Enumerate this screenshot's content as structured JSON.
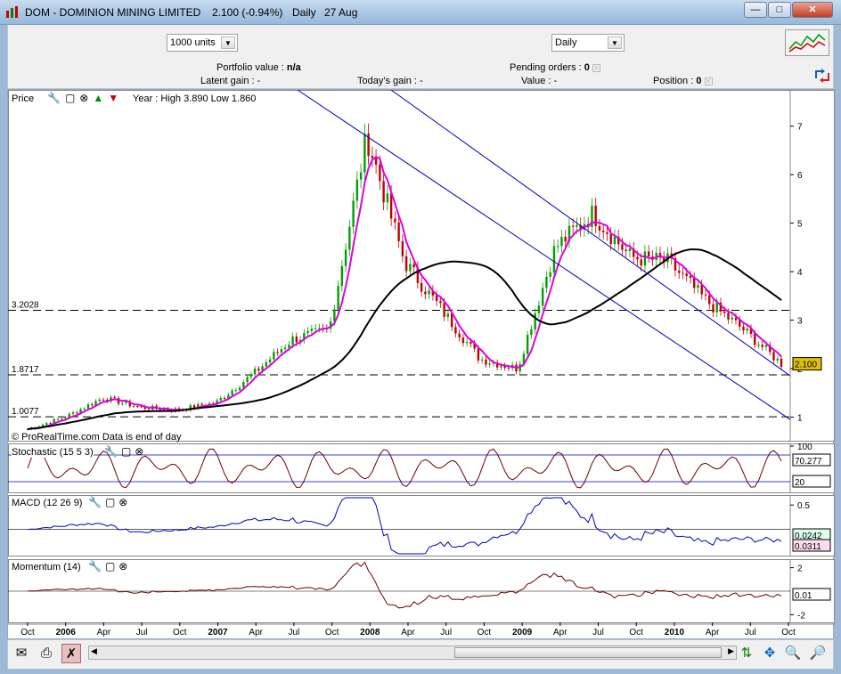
{
  "window": {
    "title": "DOM - DOMINION MINING LIMITED",
    "price": "2.100 (-0.94%)",
    "period": "Daily",
    "date": "27 Aug",
    "min_label": "—",
    "max_label": "□",
    "close_label": "✕"
  },
  "toolbar": {
    "units": "1000 units",
    "interval": "Daily"
  },
  "info": {
    "portfolio_label": "Portfolio value :",
    "portfolio_value": "n/a",
    "pending_label": "Pending orders :",
    "pending_value": "0",
    "latent_label": "Latent gain :",
    "latent_value": "-",
    "today_label": "Today's gain :",
    "today_value": "-",
    "value_label": "Value :",
    "value_value": "-",
    "position_label": "Position :",
    "position_value": "0"
  },
  "panels": {
    "price": "Price",
    "year_range": "Year : High 3.890 Low 1.860",
    "copyright": "© ProRealTime.com Data is end of day",
    "stochastic": "Stochastic (15 5 3)",
    "macd": "MACD (12 26 9)",
    "momentum": "Momentum (14)"
  },
  "levels": {
    "l1": "3.2028",
    "l2": "1.8717",
    "l3": "1.0077"
  },
  "readouts": {
    "price": "2.100",
    "stoch": "70.277",
    "stoch2": "20",
    "macd": "0.0242",
    "macd2": "0.0311",
    "mom": "0.01",
    "stoch_top": "100"
  },
  "colors": {
    "accent": "#e0c000",
    "ma_fast": "#e000e0",
    "ma_slow": "#000000",
    "channel": "#0000c0",
    "up": "#00a000",
    "down": "#c00000"
  },
  "chart_data": [
    {
      "type": "line",
      "title": "Price",
      "y_ticks": [
        1,
        2,
        3,
        4,
        5,
        6,
        7
      ],
      "ylim": [
        0.55,
        7.6
      ],
      "x": [
        "Oct",
        "2006",
        "Apr",
        "Jul",
        "Oct",
        "2007",
        "Apr",
        "Jul",
        "Oct",
        "2008",
        "Apr",
        "Jul",
        "Oct",
        "2009",
        "Apr",
        "Jul",
        "Oct",
        "2010",
        "Apr",
        "Jul",
        "Oct"
      ],
      "series": [
        {
          "values": [
            0.75,
            1.0,
            1.4,
            1.2,
            1.15,
            1.3,
            1.9,
            2.6,
            2.8,
            6.8,
            4.2,
            3.2,
            2.2,
            2.0,
            4.5,
            5.2,
            4.3,
            4.2,
            3.4,
            2.8,
            2.1
          ]
        }
      ],
      "reference_lines": [
        3.2028,
        1.8717,
        1.0077
      ]
    },
    {
      "type": "line",
      "title": "Stochastic (15 5 3)",
      "y_ticks": [
        100
      ],
      "ylim": [
        0,
        100
      ]
    },
    {
      "type": "line",
      "title": "MACD (12 26 9)",
      "y_ticks": [
        0.5
      ],
      "ylim": [
        -0.5,
        0.65
      ]
    },
    {
      "type": "line",
      "title": "Momentum (14)",
      "y_ticks": [
        2,
        -2
      ],
      "ylim": [
        -2.5,
        2.5
      ]
    }
  ]
}
